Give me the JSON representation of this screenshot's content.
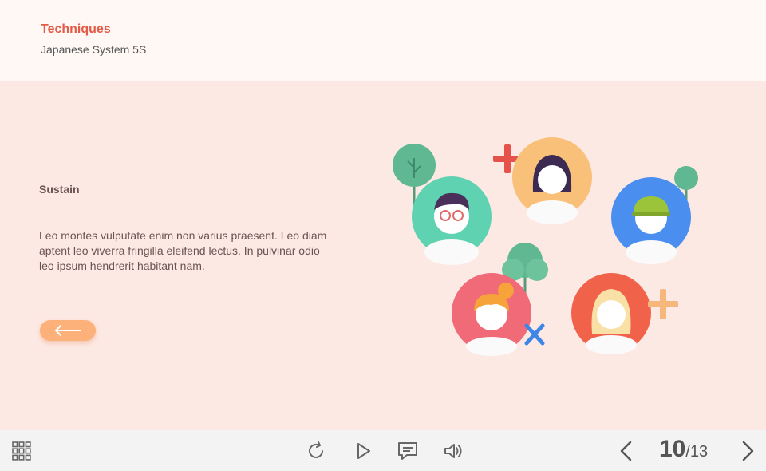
{
  "header": {
    "title": "Techniques",
    "subtitle": "Japanese System 5S"
  },
  "content": {
    "heading": "Sustain",
    "body": "Leo montes vulputate enim non varius praesent. Leo diam aptent leo viverra fringilla eleifend lectus. In pulvinar odio leo ipsum hendrerit habitant nam."
  },
  "icons": {
    "back": "arrow-left-icon",
    "menu": "grid-icon",
    "replay": "replay-icon",
    "play": "play-icon",
    "captions": "chat-bubble-icon",
    "audio": "speaker-icon",
    "prev": "chevron-left-icon",
    "next": "chevron-right-icon"
  },
  "colors": {
    "accent": "#e25c48",
    "button": "#fdb17a",
    "background": "#fde9e3",
    "header_bg": "#fff8f5",
    "footer_bg": "#f3f3f3"
  },
  "pagination": {
    "current": "10",
    "separator": "/",
    "total": "13"
  }
}
